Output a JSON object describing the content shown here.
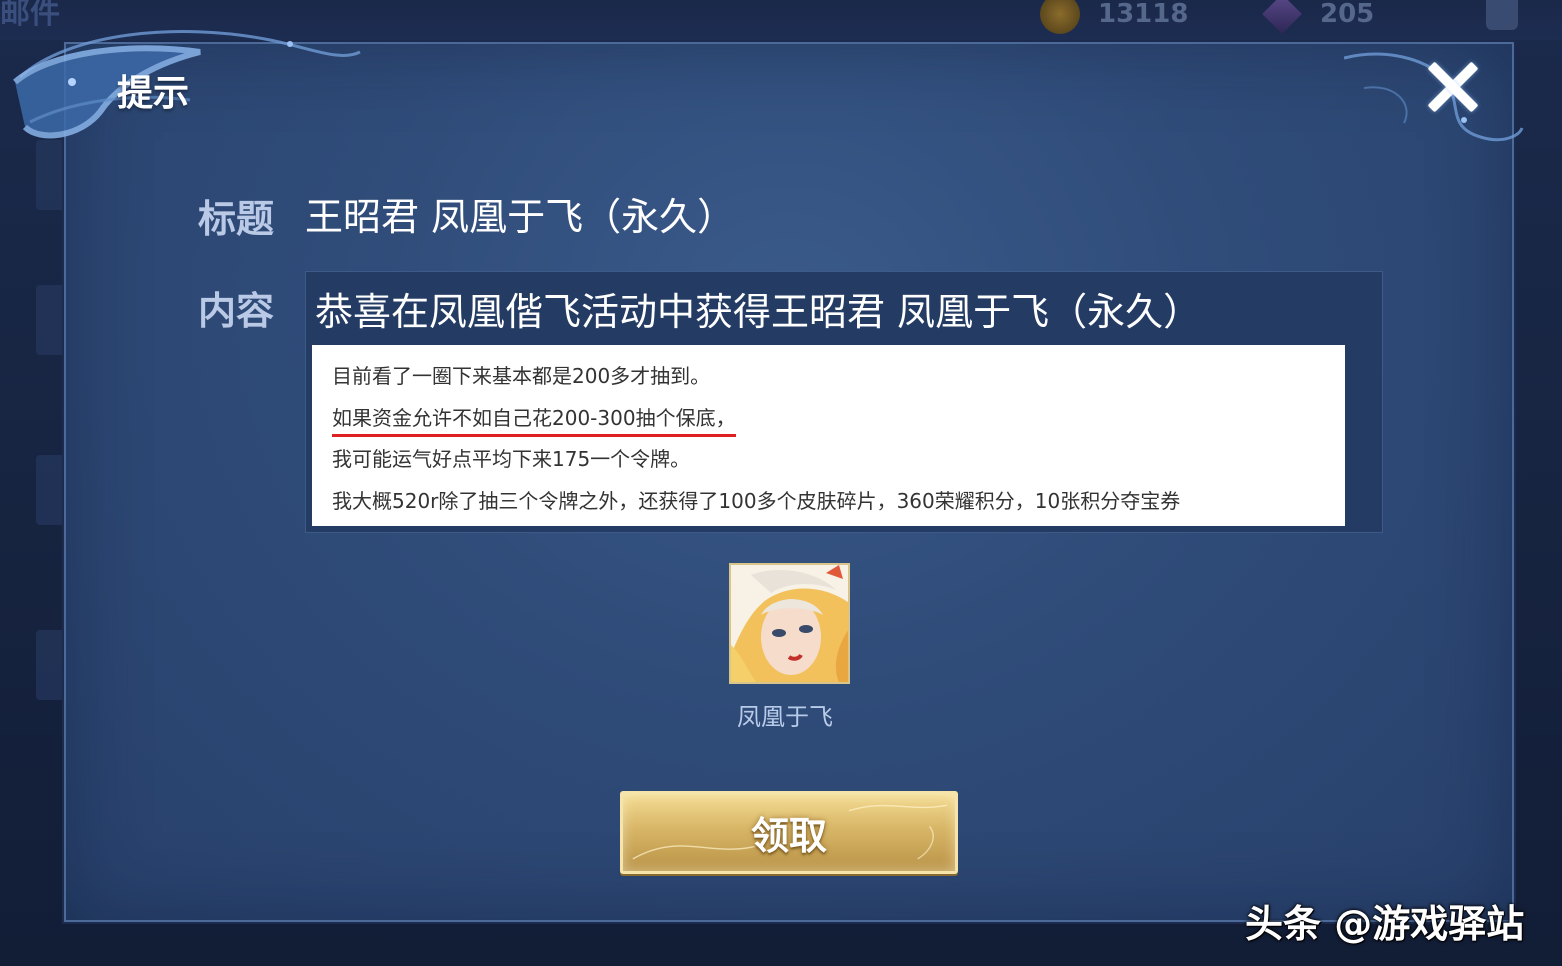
{
  "background": {
    "section_title": "邮件",
    "gold_count": "13118",
    "gem_count": "205"
  },
  "dialog": {
    "title": "提示",
    "subject_label": "标题",
    "subject_value": "王昭君 凤凰于飞（永久）",
    "content_label": "内容",
    "content_value": "恭喜在凤凰偕飞活动中获得王昭君 凤凰于飞（永久）",
    "reward": {
      "name": "凤凰于飞",
      "icon": "skin-portrait-icon"
    },
    "claim_label": "领取"
  },
  "note_overlay": {
    "lines": [
      "目前看了一圈下来基本都是200多才抽到。",
      "如果资金允许不如自己花200-300抽个保底，",
      "我可能运气好点平均下来175一个令牌。",
      "我大概520r除了抽三个令牌之外，还获得了100多个皮肤碎片，360荣耀积分，10张积分夺宝券"
    ],
    "underline_color": "#e02020"
  },
  "watermark": "头条 @游戏驿站",
  "colors": {
    "dialog_bg": "#2f4b78",
    "label": "#b9c9e6",
    "button_gold": "#d8b667"
  }
}
